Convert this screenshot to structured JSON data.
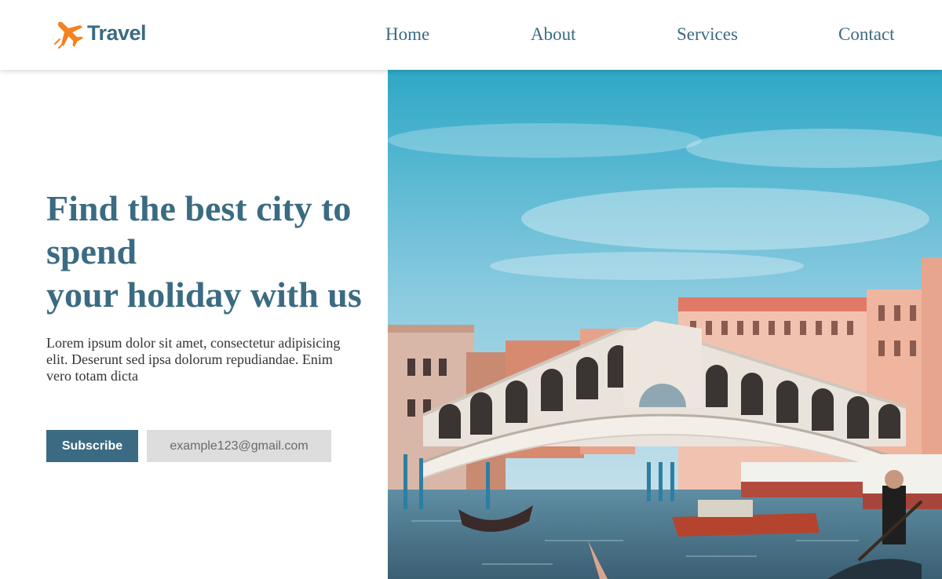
{
  "brand": {
    "name": "Travel",
    "accent": "#3b6b82",
    "logo_icon": "airplane-icon",
    "logo_icon_color": "#f5821f"
  },
  "nav": {
    "items": [
      {
        "label": "Home"
      },
      {
        "label": "About"
      },
      {
        "label": "Services"
      },
      {
        "label": "Contact"
      }
    ]
  },
  "hero": {
    "headline": [
      "Find the best city to",
      "spend",
      "your holiday with us"
    ],
    "body": "Lorem ipsum dolor sit amet, consectetur adipisicing elit. Deserunt sed ipsa dolorum repudiandae. Enim vero totam dicta",
    "subscribe_label": "Subscribe",
    "email_placeholder": "example123@gmail.com",
    "image": "venice-rialto-bridge-photo"
  }
}
